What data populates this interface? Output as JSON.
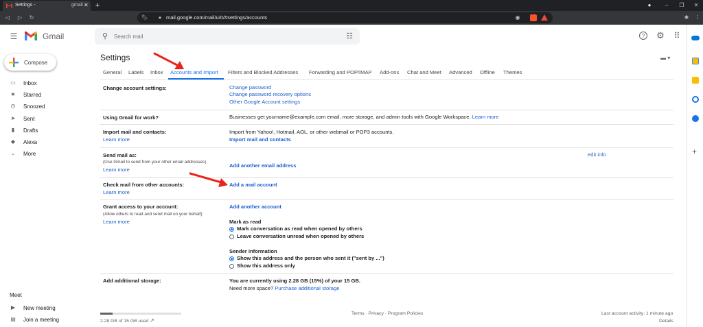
{
  "browser": {
    "tab_title": "Settings -",
    "tab_title_suffix": "gmail",
    "url": "mail.google.com/mail/u/0/#settings/accounts"
  },
  "app": {
    "name": "Gmail"
  },
  "search": {
    "placeholder": "Search mail"
  },
  "compose": {
    "label": "Compose"
  },
  "nav": [
    {
      "label": "Inbox",
      "icon": "inbox-icon"
    },
    {
      "label": "Starred",
      "icon": "star-icon"
    },
    {
      "label": "Snoozed",
      "icon": "clock-icon"
    },
    {
      "label": "Sent",
      "icon": "send-icon"
    },
    {
      "label": "Drafts",
      "icon": "draft-icon"
    },
    {
      "label": "Alexa",
      "icon": "label-icon"
    },
    {
      "label": "More",
      "icon": "chevron-down-icon"
    }
  ],
  "meet": {
    "title": "Meet",
    "new_meeting": "New meeting",
    "join_meeting": "Join a meeting"
  },
  "settings": {
    "title": "Settings",
    "tabs": [
      "General",
      "Labels",
      "Inbox",
      "Accounts and Import",
      "Filters and Blocked Addresses",
      "Forwarding and POP/IMAP",
      "Add-ons",
      "Chat and Meet",
      "Advanced",
      "Offline",
      "Themes"
    ],
    "active_tab": "Accounts and Import",
    "change_account": {
      "label": "Change account settings:",
      "links": [
        "Change password",
        "Change password recovery options",
        "Other Google Account settings"
      ]
    },
    "work": {
      "label": "Using Gmail for work?",
      "text": "Businesses get yourname@example.com email, more storage, and admin tools with Google Workspace.",
      "link": "Learn more"
    },
    "import": {
      "label": "Import mail and contacts:",
      "learn": "Learn more",
      "text": "Import from Yahoo!, Hotmail, AOL, or other webmail or POP3 accounts.",
      "action": "Import mail and contacts"
    },
    "send_as": {
      "label": "Send mail as:",
      "sub": "(Use Gmail to send from your other email addresses)",
      "learn": "Learn more",
      "action": "Add another email address",
      "edit": "edit info"
    },
    "check_mail": {
      "label": "Check mail from other accounts:",
      "learn": "Learn more",
      "action": "Add a mail account"
    },
    "grant": {
      "label": "Grant access to your account:",
      "sub": "(Allow others to read and send mail on your behalf)",
      "learn": "Learn more",
      "action": "Add another account",
      "mark_title": "Mark as read",
      "mark_opts": [
        "Mark conversation as read when opened by others",
        "Leave conversation unread when opened by others"
      ],
      "sender_title": "Sender information",
      "sender_opts": [
        "Show this address and the person who sent it (\"sent by ...\")",
        "Show this address only"
      ]
    },
    "storage": {
      "label": "Add additional storage:",
      "text": "You are currently using 2.28 GB (15%) of your 15 GB.",
      "need": "Need more space?",
      "link": "Purchase additional storage"
    }
  },
  "footer": {
    "usage": "2.28 GB of 15 GB used",
    "usage_fraction": 0.15,
    "terms": "Terms",
    "sep": "·",
    "privacy": "Privacy",
    "policies": "Program Policies",
    "activity": "Last account activity: 1 minute ago",
    "details": "Details"
  },
  "colors": {
    "accent": "#1a73e8",
    "link": "#1a5fcc",
    "arrow": "#e8261c"
  }
}
